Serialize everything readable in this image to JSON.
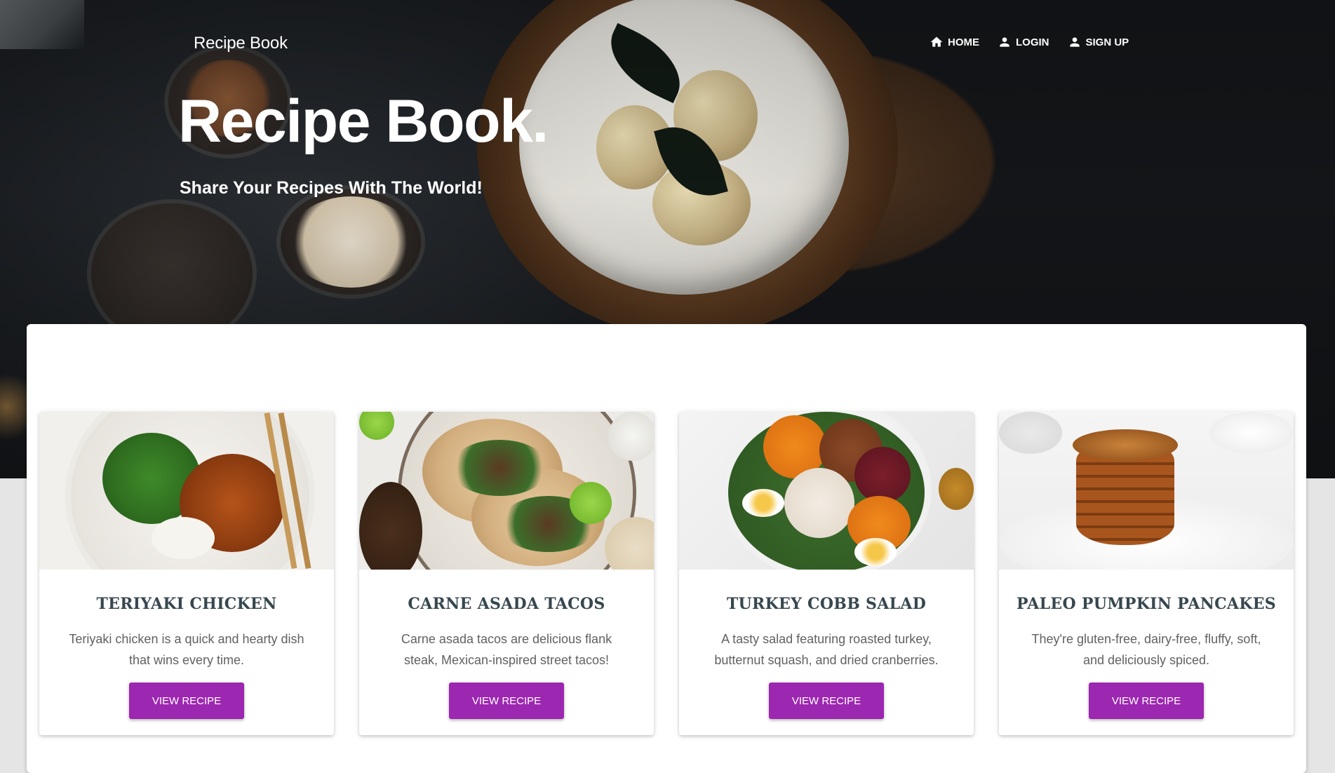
{
  "brand": "Recipe Book",
  "nav": [
    {
      "label": "Home",
      "icon": "home-icon"
    },
    {
      "label": "Login",
      "icon": "person-icon"
    },
    {
      "label": "Sign Up",
      "icon": "person-icon"
    }
  ],
  "hero": {
    "title": "Recipe Book.",
    "subtitle": "Share Your Recipes With The World!"
  },
  "cards": [
    {
      "title": "Teriyaki Chicken",
      "description": "Teriyaki chicken is a quick and hearty dish that wins every time.",
      "button": "View Recipe"
    },
    {
      "title": "Carne Asada Tacos",
      "description": "Carne asada tacos are delicious flank steak, Mexican-inspired street tacos!",
      "button": "View Recipe"
    },
    {
      "title": "Turkey Cobb Salad",
      "description": "A tasty salad featuring roasted turkey, butternut squash, and dried cranberries.",
      "button": "View Recipe"
    },
    {
      "title": "Paleo Pumpkin Pancakes",
      "description": "They're gluten-free, dairy-free, fluffy, soft, and deliciously spiced.",
      "button": "View Recipe"
    }
  ],
  "colors": {
    "accent": "#9c27b0",
    "card_title": "#37474f",
    "card_text": "#616161"
  }
}
